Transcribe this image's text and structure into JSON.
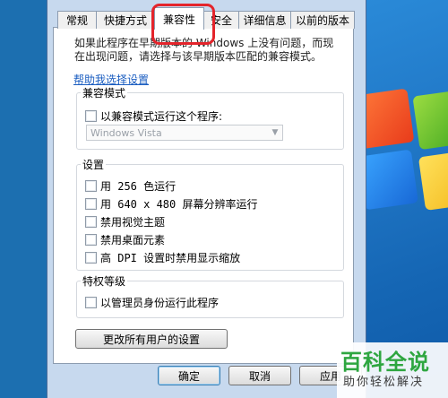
{
  "tabs": [
    {
      "label": "常规"
    },
    {
      "label": "快捷方式"
    },
    {
      "label": "兼容性"
    },
    {
      "label": "安全"
    },
    {
      "label": "详细信息"
    },
    {
      "label": "以前的版本"
    }
  ],
  "active_tab": "兼容性",
  "intro": "如果此程序在早期版本的 Windows 上没有问题，而现在出现问题，请选择与该早期版本匹配的兼容模式。",
  "help_link": "帮助我选择设置",
  "compat_mode": {
    "title": "兼容模式",
    "checkbox_label": "以兼容模式运行这个程序:",
    "select_value": "Windows Vista"
  },
  "settings": {
    "title": "设置",
    "items": [
      {
        "label": "用 256 色运行"
      },
      {
        "label": "用 640 x 480 屏幕分辨率运行"
      },
      {
        "label": "禁用视觉主题"
      },
      {
        "label": "禁用桌面元素"
      },
      {
        "label": "高 DPI 设置时禁用显示缩放"
      }
    ]
  },
  "privilege": {
    "title": "特权等级",
    "checkbox_label": "以管理员身份运行此程序"
  },
  "all_users_button": "更改所有用户的设置",
  "footer": {
    "ok": "确定",
    "cancel": "取消",
    "apply": "应用"
  },
  "watermark": {
    "title": "百科全说",
    "subtitle": "助你轻松解决"
  },
  "colors": {
    "highlight": "#e4242b",
    "link": "#1a5dc0",
    "watermark_green": "#2ea640"
  }
}
